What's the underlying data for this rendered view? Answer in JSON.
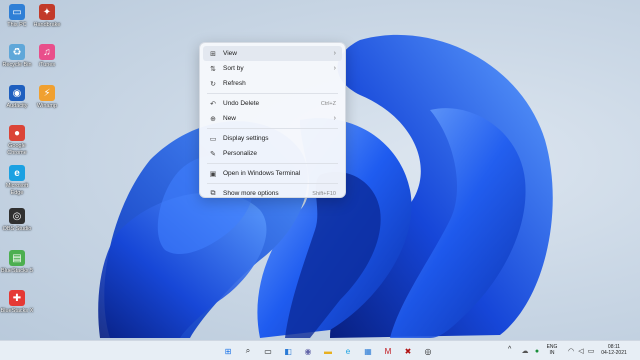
{
  "desktop": {
    "icons": [
      {
        "label": "This PC",
        "icon": "monitor-icon",
        "color": "#2f7fd6",
        "glyph": "▭"
      },
      {
        "label": "Handbrake",
        "icon": "handbrake-icon",
        "color": "#c23a2a",
        "glyph": "✦"
      },
      {
        "label": "Recycle Bin",
        "icon": "recycle-bin-icon",
        "color": "#5fa7d9",
        "glyph": "♻"
      },
      {
        "label": "iTunes",
        "icon": "itunes-icon",
        "color": "#e94f8b",
        "glyph": "♫"
      },
      {
        "label": "Audacity",
        "icon": "audacity-icon",
        "color": "#1e5fbf",
        "glyph": "◉"
      },
      {
        "label": "Winamp",
        "icon": "winamp-icon",
        "color": "#f0a030",
        "glyph": "⚡"
      },
      {
        "label": "Google Chrome",
        "icon": "chrome-icon",
        "color": "#db4437",
        "glyph": "●"
      },
      {
        "label": "Microsoft Edge",
        "icon": "edge-icon",
        "color": "#1ba1e2",
        "glyph": "e"
      },
      {
        "label": "OBS Studio",
        "icon": "obs-icon",
        "color": "#303030",
        "glyph": "◎"
      },
      {
        "label": "BlueStacks 5",
        "icon": "bluestacks-icon",
        "color": "#4caf50",
        "glyph": "▤"
      },
      {
        "label": "BlueStacks X",
        "icon": "bluestacks-x-icon",
        "color": "#e53935",
        "glyph": "✚"
      }
    ]
  },
  "context_menu": {
    "items": [
      {
        "label": "View",
        "icon": "grid-icon",
        "glyph": "⊞",
        "right": "",
        "submenu": true
      },
      {
        "label": "Sort by",
        "icon": "sort-icon",
        "glyph": "⇅",
        "right": "",
        "submenu": true
      },
      {
        "label": "Refresh",
        "icon": "refresh-icon",
        "glyph": "↻",
        "right": "",
        "submenu": false
      },
      {
        "label": "Undo Delete",
        "icon": "undo-icon",
        "glyph": "↶",
        "right": "Ctrl+Z",
        "submenu": false
      },
      {
        "label": "New",
        "icon": "plus-circle-icon",
        "glyph": "⊕",
        "right": "",
        "submenu": true
      },
      {
        "label": "Display settings",
        "icon": "display-icon",
        "glyph": "▭",
        "right": "",
        "submenu": false
      },
      {
        "label": "Personalize",
        "icon": "brush-icon",
        "glyph": "✎",
        "right": "",
        "submenu": false
      },
      {
        "label": "Open in Windows Terminal",
        "icon": "terminal-icon",
        "glyph": "▣",
        "right": "",
        "submenu": false
      },
      {
        "label": "Show more options",
        "icon": "more-options-icon",
        "glyph": "⧉",
        "right": "Shift+F10",
        "submenu": false
      }
    ]
  },
  "taskbar": {
    "apps": [
      {
        "name": "start",
        "icon": "windows-start-icon",
        "glyph": "⊞",
        "color": "#1a73e8"
      },
      {
        "name": "search",
        "icon": "search-icon",
        "glyph": "⌕",
        "color": "#222222"
      },
      {
        "name": "task-view",
        "icon": "task-view-icon",
        "glyph": "▭",
        "color": "#222222"
      },
      {
        "name": "widgets",
        "icon": "widgets-icon",
        "glyph": "◧",
        "color": "#2b7bd6"
      },
      {
        "name": "chat",
        "icon": "chat-icon",
        "glyph": "◉",
        "color": "#6264a7"
      },
      {
        "name": "file-explorer",
        "icon": "folder-icon",
        "glyph": "▬",
        "color": "#e8b020"
      },
      {
        "name": "edge",
        "icon": "edge-icon",
        "glyph": "e",
        "color": "#1ba1e2"
      },
      {
        "name": "store",
        "icon": "store-icon",
        "glyph": "▦",
        "color": "#2b7bd6"
      },
      {
        "name": "mcafee",
        "icon": "mcafee-icon",
        "glyph": "M",
        "color": "#c0161c"
      },
      {
        "name": "app",
        "icon": "shield-app-icon",
        "glyph": "✖",
        "color": "#b01010"
      },
      {
        "name": "obs",
        "icon": "obs-icon",
        "glyph": "◎",
        "color": "#222222"
      }
    ],
    "tray": {
      "chevron": "^",
      "lang_top": "ENG",
      "lang_bottom": "IN",
      "time": "08:11",
      "date": "04-12-2021"
    }
  }
}
